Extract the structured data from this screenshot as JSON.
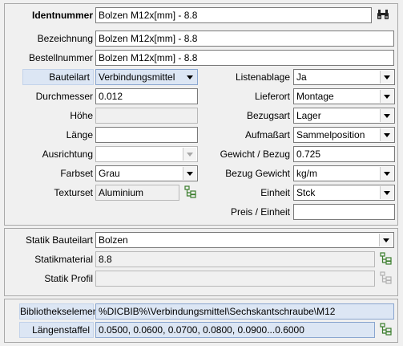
{
  "top": {
    "identnummer": {
      "label": "Identnummer",
      "value": "Bolzen M12x[mm] - 8.8"
    },
    "bezeichnung": {
      "label": "Bezeichnung",
      "value": "Bolzen M12x[mm] - 8.8"
    },
    "bestellnummer": {
      "label": "Bestellnummer",
      "value": "Bolzen M12x[mm] - 8.8"
    },
    "bauteilart": {
      "label": "Bauteilart",
      "value": "Verbindungsmittel"
    },
    "durchmesser": {
      "label": "Durchmesser",
      "value": "0.012"
    },
    "hoehe": {
      "label": "Höhe",
      "value": ""
    },
    "laenge": {
      "label": "Länge",
      "value": ""
    },
    "ausrichtung": {
      "label": "Ausrichtung",
      "value": ""
    },
    "farbset": {
      "label": "Farbset",
      "value": "Grau"
    },
    "texturset": {
      "label": "Texturset",
      "value": "Aluminium"
    },
    "listenablage": {
      "label": "Listenablage",
      "value": "Ja"
    },
    "lieferort": {
      "label": "Lieferort",
      "value": "Montage"
    },
    "bezugsart": {
      "label": "Bezugsart",
      "value": "Lager"
    },
    "aufmassart": {
      "label": "Aufmaßart",
      "value": "Sammelposition"
    },
    "gewicht_bezug": {
      "label": "Gewicht / Bezug",
      "value": "0.725"
    },
    "bezug_gewicht": {
      "label": "Bezug Gewicht",
      "value": "kg/m"
    },
    "einheit": {
      "label": "Einheit",
      "value": "Stck"
    },
    "preis_einheit": {
      "label": "Preis / Einheit",
      "value": ""
    }
  },
  "statik": {
    "bauteilart": {
      "label": "Statik Bauteilart",
      "value": "Bolzen"
    },
    "material": {
      "label": "Statikmaterial",
      "value": "8.8"
    },
    "profil": {
      "label": "Statik Profil",
      "value": ""
    }
  },
  "bibliothek": {
    "element": {
      "label": "Bibliothekselement",
      "value": "%DICBIB%\\Verbindungsmittel\\Sechskantschraube\\M12"
    },
    "laengenstaffel": {
      "label": "Längenstaffel",
      "value": "0.0500, 0.0600, 0.0700, 0.0800, 0.0900...0.6000"
    }
  },
  "icons": {
    "search": "binoculars-icon",
    "tree": "tree-picker-icon"
  },
  "colors": {
    "highlight": "#dce6f4",
    "tree_icon": "#3a7d2c"
  }
}
